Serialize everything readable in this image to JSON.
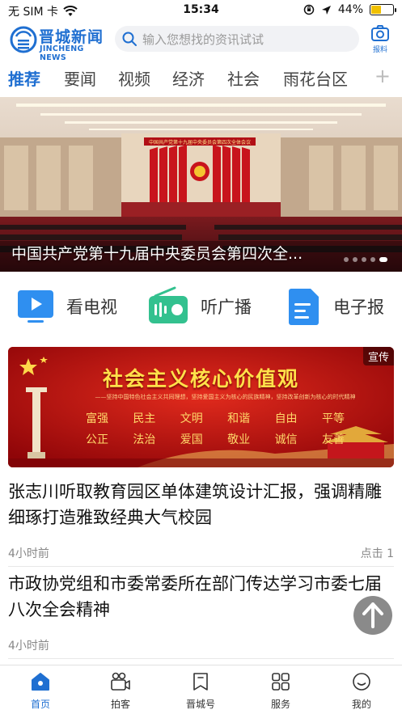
{
  "status_bar": {
    "carrier": "无 SIM 卡",
    "time": "15:34",
    "battery": "44%",
    "battery_level": 0.44,
    "icons": [
      "wifi-icon",
      "orientation-lock-icon",
      "location-icon",
      "battery-icon"
    ]
  },
  "header": {
    "logo_name": "晋城新闻",
    "logo_sub": "JINCHENG NEWS",
    "search_placeholder": "输入您想找的资讯试试",
    "report_label": "报料"
  },
  "tabs": [
    {
      "label": "推荐",
      "active": true
    },
    {
      "label": "要闻",
      "active": false
    },
    {
      "label": "视频",
      "active": false
    },
    {
      "label": "经济",
      "active": false
    },
    {
      "label": "社会",
      "active": false
    },
    {
      "label": "雨花台区",
      "active": false
    }
  ],
  "tabs_more": "+",
  "hero": {
    "caption": "中国共产党第十九届中央委员会第四次全...",
    "banner_text": "中国共产党第十九届中央委员会第四次全体会议",
    "slide_count": 5,
    "active_slide": 4
  },
  "quick_links": [
    {
      "label": "看电视",
      "icon": "tv-play-icon"
    },
    {
      "label": "听广播",
      "icon": "radio-icon"
    },
    {
      "label": "电子报",
      "icon": "e-paper-icon"
    }
  ],
  "ad": {
    "badge": "宣传",
    "title": "社会主义核心价值观",
    "tagline": "——坚持中国特色社会主义共同理想，坚持爱国主义为核心的民族精神，坚持改革创新为核心的时代精神",
    "values_row1": [
      "富强",
      "民主",
      "文明",
      "和谐",
      "自由",
      "平等"
    ],
    "values_row2": [
      "公正",
      "法治",
      "爱国",
      "敬业",
      "诚信",
      "友善"
    ]
  },
  "articles": [
    {
      "headline": "张志川听取教育园区单体建筑设计汇报，强调精雕细琢打造雅致经典大气校园",
      "time": "4小时前",
      "clicks": "点击 1"
    },
    {
      "headline": "市政协党组和市委常委所在部门传达学习市委七届八次全会精神",
      "time": "4小时前",
      "clicks": ""
    }
  ],
  "bottom_nav": [
    {
      "label": "首页",
      "icon": "home-icon",
      "active": true
    },
    {
      "label": "拍客",
      "icon": "camera-video-icon",
      "active": false
    },
    {
      "label": "晋城号",
      "icon": "bookmark-icon",
      "active": false
    },
    {
      "label": "服务",
      "icon": "grid-apps-icon",
      "active": false
    },
    {
      "label": "我的",
      "icon": "profile-icon",
      "active": false
    }
  ],
  "colors": {
    "brand": "#1f6fd1",
    "ad_red": "#b80d0d",
    "ad_gold": "#ffe14a",
    "battery": "#f0c000"
  }
}
